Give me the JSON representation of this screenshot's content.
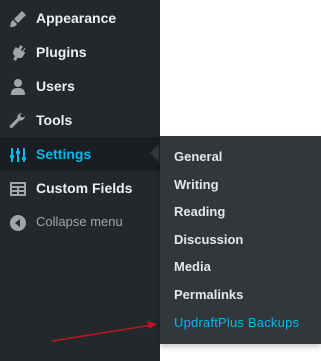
{
  "sidebar": {
    "items": [
      {
        "label": "Appearance",
        "icon": "paintbrush-icon"
      },
      {
        "label": "Plugins",
        "icon": "plug-icon"
      },
      {
        "label": "Users",
        "icon": "user-icon"
      },
      {
        "label": "Tools",
        "icon": "wrench-icon"
      },
      {
        "label": "Settings",
        "icon": "settings-icon"
      },
      {
        "label": "Custom Fields",
        "icon": "custom-fields-icon"
      },
      {
        "label": "Collapse menu",
        "icon": "collapse-icon"
      }
    ]
  },
  "submenu": {
    "items": [
      {
        "label": "General"
      },
      {
        "label": "Writing"
      },
      {
        "label": "Reading"
      },
      {
        "label": "Discussion"
      },
      {
        "label": "Media"
      },
      {
        "label": "Permalinks"
      },
      {
        "label": "UpdraftPlus Backups"
      }
    ]
  },
  "colors": {
    "sidebar_bg": "#23282d",
    "submenu_bg": "#32373c",
    "active_text": "#00b9eb",
    "annotation_arrow": "#c0141b"
  }
}
